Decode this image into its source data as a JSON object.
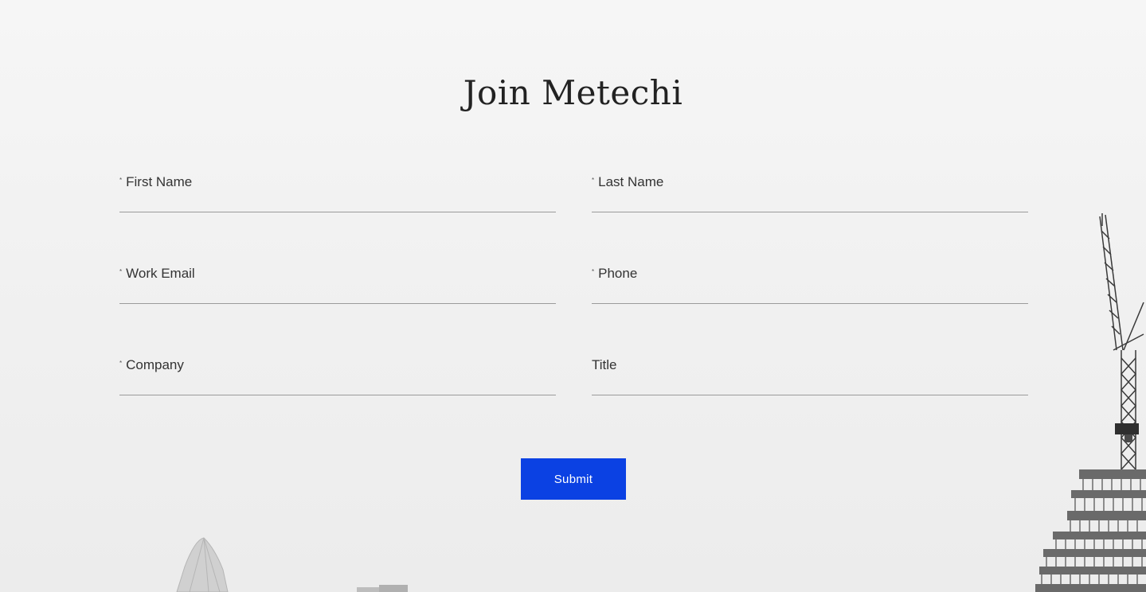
{
  "form": {
    "title": "Join Metechi",
    "fields": [
      {
        "label": "First Name",
        "required": "*",
        "value": ""
      },
      {
        "label": "Last Name",
        "required": "*",
        "value": ""
      },
      {
        "label": "Work Email",
        "required": "*",
        "value": ""
      },
      {
        "label": "Phone",
        "required": "*",
        "value": ""
      },
      {
        "label": "Company",
        "required": "*",
        "value": ""
      },
      {
        "label": "Title",
        "required": "",
        "value": ""
      }
    ],
    "submit_label": "Submit"
  },
  "colors": {
    "accent": "#0b41e3",
    "text": "#333333",
    "underline": "#9a9a9a",
    "background": "#efefef"
  }
}
